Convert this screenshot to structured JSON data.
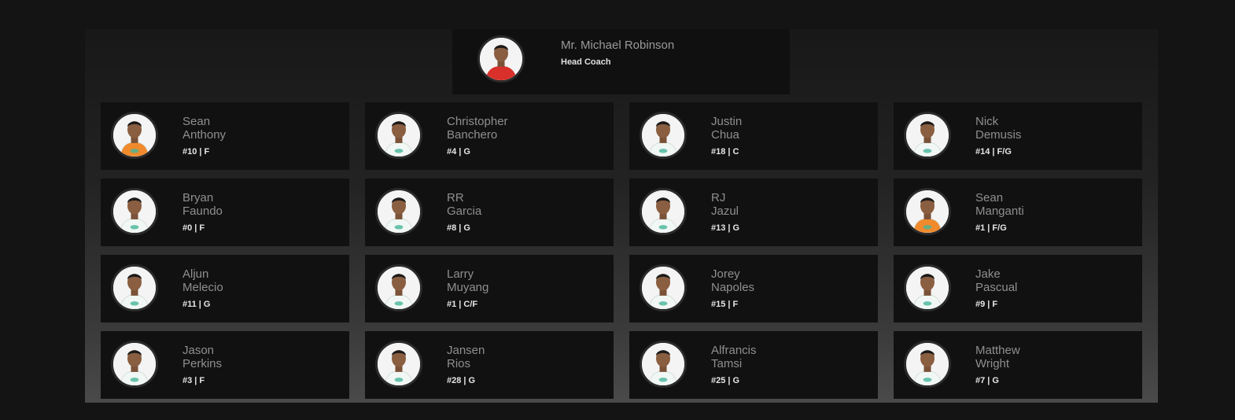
{
  "coach": {
    "name": "Mr. Michael Robinson",
    "role": "Head Coach",
    "jersey_color": "#d9302b"
  },
  "players": [
    {
      "first": "Sean",
      "last": "Anthony",
      "meta": "#10 | F",
      "jersey_color": "#f08a2c"
    },
    {
      "first": "Christopher",
      "last": "Banchero",
      "meta": "#4 | G",
      "jersey_color": "#f1f7f4"
    },
    {
      "first": "Justin",
      "last": "Chua",
      "meta": "#18 | C",
      "jersey_color": "#f1f7f4"
    },
    {
      "first": "Nick",
      "last": "Demusis",
      "meta": "#14 | F/G",
      "jersey_color": "#f1f7f4"
    },
    {
      "first": "Bryan",
      "last": "Faundo",
      "meta": "#0 | F",
      "jersey_color": "#f1f7f4"
    },
    {
      "first": "RR",
      "last": "Garcia",
      "meta": "#8 | G",
      "jersey_color": "#f1f7f4"
    },
    {
      "first": "RJ",
      "last": "Jazul",
      "meta": "#13 | G",
      "jersey_color": "#f1f7f4"
    },
    {
      "first": "Sean",
      "last": "Manganti",
      "meta": "#1 | F/G",
      "jersey_color": "#f08a2c"
    },
    {
      "first": "Aljun",
      "last": "Melecio",
      "meta": "#11 | G",
      "jersey_color": "#f1f7f4"
    },
    {
      "first": "Larry",
      "last": "Muyang",
      "meta": "#1 | C/F",
      "jersey_color": "#f1f7f4"
    },
    {
      "first": "Jorey",
      "last": "Napoles",
      "meta": "#15 | F",
      "jersey_color": "#f1f7f4"
    },
    {
      "first": "Jake",
      "last": "Pascual",
      "meta": "#9 | F",
      "jersey_color": "#f1f7f4"
    },
    {
      "first": "Jason",
      "last": "Perkins",
      "meta": "#3 | F",
      "jersey_color": "#f1f7f4"
    },
    {
      "first": "Jansen",
      "last": "Rios",
      "meta": "#28 | G",
      "jersey_color": "#f1f7f4"
    },
    {
      "first": "Alfrancis",
      "last": "Tamsi",
      "meta": "#25 | G",
      "jersey_color": "#f1f7f4"
    },
    {
      "first": "Matthew",
      "last": "Wright",
      "meta": "#7 | G",
      "jersey_color": "#f1f7f4"
    }
  ]
}
